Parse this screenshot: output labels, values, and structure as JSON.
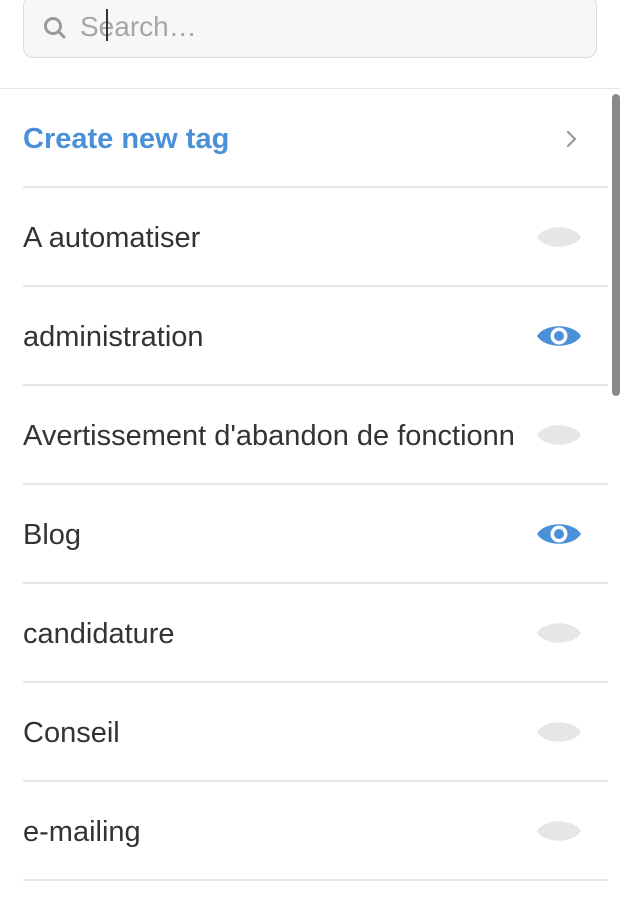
{
  "search": {
    "placeholder": "Search…",
    "value": ""
  },
  "create": {
    "label": "Create new tag"
  },
  "colors": {
    "accent": "#4a90d9",
    "eye_visible": "#4a90d9",
    "eye_hidden": "#e6e6e6"
  },
  "tags": [
    {
      "label": "A automatiser",
      "visible": false
    },
    {
      "label": "administration",
      "visible": true
    },
    {
      "label": "Avertissement d'abandon de fonctionnalité",
      "visible": false
    },
    {
      "label": "Blog",
      "visible": true
    },
    {
      "label": "candidature",
      "visible": false
    },
    {
      "label": "Conseil",
      "visible": false
    },
    {
      "label": "e-mailing",
      "visible": false
    }
  ]
}
